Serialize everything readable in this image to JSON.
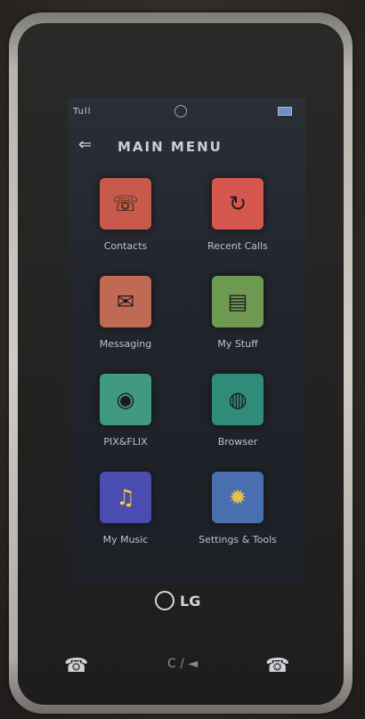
{
  "status": {
    "signal_text": "Tull",
    "battery_color": "#6f8dc6"
  },
  "menu": {
    "title": "MAIN MENU",
    "back_icon": "back-arrow-icon"
  },
  "tiles": [
    {
      "label": "Contacts",
      "icon": "contacts-icon",
      "color": "#c75a4a"
    },
    {
      "label": "Recent Calls",
      "icon": "recent-calls-icon",
      "color": "#d6574e"
    },
    {
      "label": "Messaging",
      "icon": "envelope-icon",
      "color": "#c06a54"
    },
    {
      "label": "My Stuff",
      "icon": "my-stuff-icon",
      "color": "#6f9a54"
    },
    {
      "label": "PIX&FLIX",
      "icon": "media-icon",
      "color": "#3f9a7f"
    },
    {
      "label": "Browser",
      "icon": "globe-icon",
      "color": "#2f8c7a"
    },
    {
      "label": "My Music",
      "icon": "music-note-icon",
      "color": "#4a4cb2"
    },
    {
      "label": "Settings & Tools",
      "icon": "settings-icon",
      "color": "#4a6fb0"
    }
  ],
  "brand": {
    "logo_text": "LG"
  },
  "keys": {
    "center_text": "C / ◄"
  }
}
